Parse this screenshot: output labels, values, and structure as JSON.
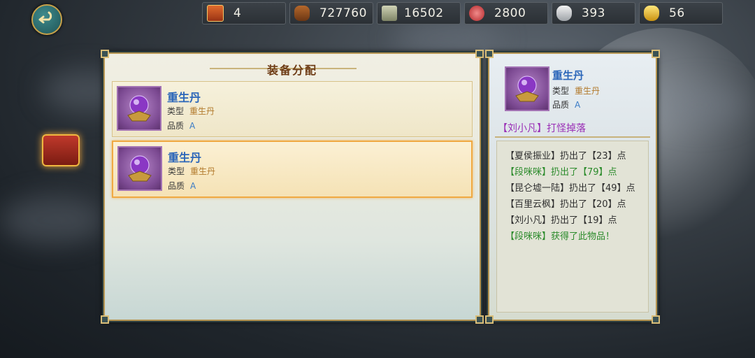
{
  "resources": [
    {
      "icon": "token-icon",
      "value": "4"
    },
    {
      "icon": "wood-icon",
      "value": "727760"
    },
    {
      "icon": "silver-bars-icon",
      "value": "16502"
    },
    {
      "icon": "meat-icon",
      "value": "2800"
    },
    {
      "icon": "silver-ingot-icon",
      "value": "393"
    },
    {
      "icon": "gold-ingot-icon",
      "value": "56"
    }
  ],
  "panel": {
    "title": "装备分配"
  },
  "items": [
    {
      "name": "重生丹",
      "type_label": "类型",
      "type_value": "重生丹",
      "quality_label": "品质",
      "quality_value": "A",
      "selected": false
    },
    {
      "name": "重生丹",
      "type_label": "类型",
      "type_value": "重生丹",
      "quality_label": "品质",
      "quality_value": "A",
      "selected": true
    }
  ],
  "detail": {
    "name": "重生丹",
    "type_label": "类型",
    "type_value": "重生丹",
    "quality_label": "品质",
    "quality_value": "A",
    "drop_text": "【刘小凡】打怪掉落"
  },
  "log": [
    {
      "text": "【夏侯振业】扔出了【23】点",
      "color": "dark"
    },
    {
      "text": "【段咪咪】扔出了【79】点",
      "color": "green"
    },
    {
      "text": "【昆仑墟一陆】扔出了【49】点",
      "color": "dark"
    },
    {
      "text": "【百里云枫】扔出了【20】点",
      "color": "dark"
    },
    {
      "text": "【刘小凡】扔出了【19】点",
      "color": "dark"
    },
    {
      "text": "【段咪咪】获得了此物品！",
      "color": "green"
    }
  ]
}
